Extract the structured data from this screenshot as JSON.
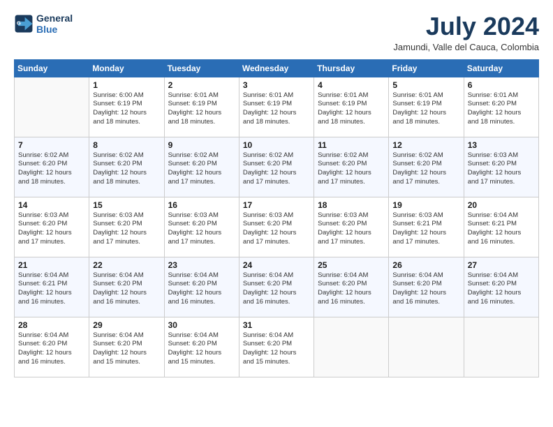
{
  "header": {
    "logo_line1": "General",
    "logo_line2": "Blue",
    "month_year": "July 2024",
    "location": "Jamundi, Valle del Cauca, Colombia"
  },
  "days_of_week": [
    "Sunday",
    "Monday",
    "Tuesday",
    "Wednesday",
    "Thursday",
    "Friday",
    "Saturday"
  ],
  "weeks": [
    [
      {
        "day": "",
        "info": ""
      },
      {
        "day": "1",
        "info": "Sunrise: 6:00 AM\nSunset: 6:19 PM\nDaylight: 12 hours\nand 18 minutes."
      },
      {
        "day": "2",
        "info": "Sunrise: 6:01 AM\nSunset: 6:19 PM\nDaylight: 12 hours\nand 18 minutes."
      },
      {
        "day": "3",
        "info": "Sunrise: 6:01 AM\nSunset: 6:19 PM\nDaylight: 12 hours\nand 18 minutes."
      },
      {
        "day": "4",
        "info": "Sunrise: 6:01 AM\nSunset: 6:19 PM\nDaylight: 12 hours\nand 18 minutes."
      },
      {
        "day": "5",
        "info": "Sunrise: 6:01 AM\nSunset: 6:19 PM\nDaylight: 12 hours\nand 18 minutes."
      },
      {
        "day": "6",
        "info": "Sunrise: 6:01 AM\nSunset: 6:20 PM\nDaylight: 12 hours\nand 18 minutes."
      }
    ],
    [
      {
        "day": "7",
        "info": "Sunrise: 6:02 AM\nSunset: 6:20 PM\nDaylight: 12 hours\nand 18 minutes."
      },
      {
        "day": "8",
        "info": "Sunrise: 6:02 AM\nSunset: 6:20 PM\nDaylight: 12 hours\nand 18 minutes."
      },
      {
        "day": "9",
        "info": "Sunrise: 6:02 AM\nSunset: 6:20 PM\nDaylight: 12 hours\nand 17 minutes."
      },
      {
        "day": "10",
        "info": "Sunrise: 6:02 AM\nSunset: 6:20 PM\nDaylight: 12 hours\nand 17 minutes."
      },
      {
        "day": "11",
        "info": "Sunrise: 6:02 AM\nSunset: 6:20 PM\nDaylight: 12 hours\nand 17 minutes."
      },
      {
        "day": "12",
        "info": "Sunrise: 6:02 AM\nSunset: 6:20 PM\nDaylight: 12 hours\nand 17 minutes."
      },
      {
        "day": "13",
        "info": "Sunrise: 6:03 AM\nSunset: 6:20 PM\nDaylight: 12 hours\nand 17 minutes."
      }
    ],
    [
      {
        "day": "14",
        "info": "Sunrise: 6:03 AM\nSunset: 6:20 PM\nDaylight: 12 hours\nand 17 minutes."
      },
      {
        "day": "15",
        "info": "Sunrise: 6:03 AM\nSunset: 6:20 PM\nDaylight: 12 hours\nand 17 minutes."
      },
      {
        "day": "16",
        "info": "Sunrise: 6:03 AM\nSunset: 6:20 PM\nDaylight: 12 hours\nand 17 minutes."
      },
      {
        "day": "17",
        "info": "Sunrise: 6:03 AM\nSunset: 6:20 PM\nDaylight: 12 hours\nand 17 minutes."
      },
      {
        "day": "18",
        "info": "Sunrise: 6:03 AM\nSunset: 6:20 PM\nDaylight: 12 hours\nand 17 minutes."
      },
      {
        "day": "19",
        "info": "Sunrise: 6:03 AM\nSunset: 6:21 PM\nDaylight: 12 hours\nand 17 minutes."
      },
      {
        "day": "20",
        "info": "Sunrise: 6:04 AM\nSunset: 6:21 PM\nDaylight: 12 hours\nand 16 minutes."
      }
    ],
    [
      {
        "day": "21",
        "info": "Sunrise: 6:04 AM\nSunset: 6:21 PM\nDaylight: 12 hours\nand 16 minutes."
      },
      {
        "day": "22",
        "info": "Sunrise: 6:04 AM\nSunset: 6:20 PM\nDaylight: 12 hours\nand 16 minutes."
      },
      {
        "day": "23",
        "info": "Sunrise: 6:04 AM\nSunset: 6:20 PM\nDaylight: 12 hours\nand 16 minutes."
      },
      {
        "day": "24",
        "info": "Sunrise: 6:04 AM\nSunset: 6:20 PM\nDaylight: 12 hours\nand 16 minutes."
      },
      {
        "day": "25",
        "info": "Sunrise: 6:04 AM\nSunset: 6:20 PM\nDaylight: 12 hours\nand 16 minutes."
      },
      {
        "day": "26",
        "info": "Sunrise: 6:04 AM\nSunset: 6:20 PM\nDaylight: 12 hours\nand 16 minutes."
      },
      {
        "day": "27",
        "info": "Sunrise: 6:04 AM\nSunset: 6:20 PM\nDaylight: 12 hours\nand 16 minutes."
      }
    ],
    [
      {
        "day": "28",
        "info": "Sunrise: 6:04 AM\nSunset: 6:20 PM\nDaylight: 12 hours\nand 16 minutes."
      },
      {
        "day": "29",
        "info": "Sunrise: 6:04 AM\nSunset: 6:20 PM\nDaylight: 12 hours\nand 15 minutes."
      },
      {
        "day": "30",
        "info": "Sunrise: 6:04 AM\nSunset: 6:20 PM\nDaylight: 12 hours\nand 15 minutes."
      },
      {
        "day": "31",
        "info": "Sunrise: 6:04 AM\nSunset: 6:20 PM\nDaylight: 12 hours\nand 15 minutes."
      },
      {
        "day": "",
        "info": ""
      },
      {
        "day": "",
        "info": ""
      },
      {
        "day": "",
        "info": ""
      }
    ]
  ]
}
